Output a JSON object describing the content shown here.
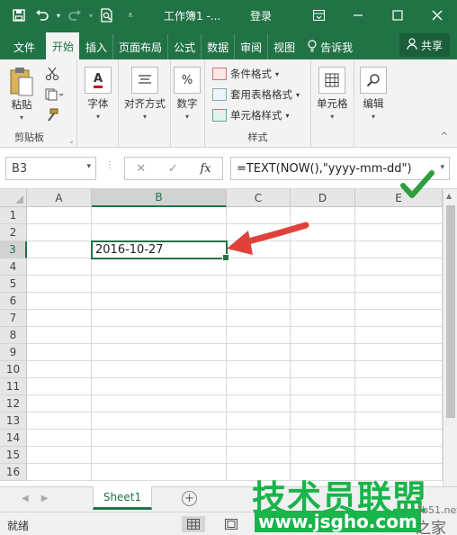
{
  "titlebar": {
    "title": "工作簿1 -...",
    "login": "登录",
    "icons": [
      "save-icon",
      "undo-icon",
      "redo-icon",
      "print-preview-icon",
      "customize-icon",
      "ribbon-display-icon",
      "minimize-icon",
      "maximize-icon",
      "close-icon"
    ]
  },
  "tabs": {
    "items": [
      "文件",
      "开始",
      "插入",
      "页面布局",
      "公式",
      "数据",
      "审阅",
      "视图"
    ],
    "active": "开始",
    "tell_me": "告诉我",
    "share": "共享"
  },
  "ribbon": {
    "clipboard": {
      "paste": "粘贴",
      "label": "剪贴板"
    },
    "font": "字体",
    "alignment": "对齐方式",
    "number": "数字",
    "styles": {
      "conditional": "条件格式",
      "table": "套用表格格式",
      "cell_styles": "单元格样式",
      "label": "样式"
    },
    "cells": "单元格",
    "editing": "编辑"
  },
  "formula_bar": {
    "name_box": "B3",
    "formula": "=TEXT(NOW(),\"yyyy-mm-dd\")",
    "fx": "fx"
  },
  "grid": {
    "columns": [
      "A",
      "B",
      "C",
      "D",
      "E"
    ],
    "rows": [
      "1",
      "2",
      "3",
      "4",
      "5",
      "6",
      "7",
      "8",
      "9",
      "10",
      "11",
      "12",
      "13",
      "14",
      "15",
      "16"
    ],
    "selected_cell": "B3",
    "selected_value": "2016-10-27"
  },
  "sheets": {
    "tabs": [
      "Sheet1"
    ],
    "active": "Sheet1"
  },
  "status": {
    "ready": "就绪"
  },
  "watermark": {
    "main": "技术员联盟",
    "url": "www.jsgho.com",
    "side_top": "jb51.net",
    "side_bottom": "之家"
  },
  "colors": {
    "accent": "#217346",
    "arrow": "#e0413b",
    "check": "#2e9e3e"
  }
}
